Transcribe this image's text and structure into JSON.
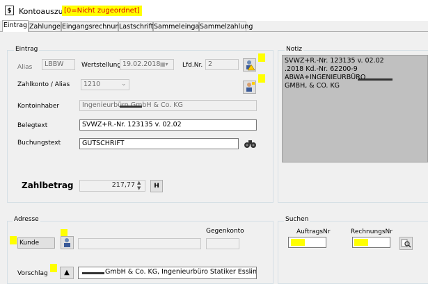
{
  "window": {
    "title": "Kontoauszug",
    "status": "[0=Nicht zugeordnet]"
  },
  "tabs": [
    "Eintrag",
    "Zahlungen",
    "Eingangsrechnung",
    "Lastschrift",
    "Sammeleingang",
    "Sammelzahlung"
  ],
  "entry": {
    "group_label": "Eintrag",
    "alias_label": "Alias",
    "alias_value": "LBBW",
    "wertstellung_label": "Wertstellung",
    "wertstellung_value": "19.02.2018",
    "lfdnr_label": "Lfd.Nr.",
    "lfdnr_value": "2",
    "zahlkonto_label": "Zahlkonto / Alias",
    "zahlkonto_value": "1210",
    "kontoinhaber_label": "Kontoinhaber",
    "kontoinhaber_value": "Ingenieurbüro            GmbH & Co. KG",
    "belegtext_label": "Belegtext",
    "belegtext_value": "SVWZ+R.-Nr. 123135 v. 02.02",
    "buchungstext_label": "Buchungstext",
    "buchungstext_value": "GUTSCHRIFT",
    "zahlbetrag_label": "Zahlbetrag",
    "zahlbetrag_value": "217,77",
    "h_button": "H"
  },
  "notiz": {
    "label": "Notiz",
    "lines": [
      "SVWZ+R.-Nr. 123135 v. 02.02",
      ".2018 Kd.-Nr. 62200-9",
      "ABWA+INGENIEURBÜRO",
      "GMBH, & CO. KG"
    ]
  },
  "adresse": {
    "label": "Adresse",
    "kunde_label": "Kunde",
    "gegenkonto_label": "Gegenkonto",
    "vorschlag_label": "Vorschlag",
    "vorschlag_value": "GmbH & Co. KG, Ingenieurbüro Statiker Esslingen am"
  },
  "suchen": {
    "label": "Suchen",
    "auftragsnr_label": "AuftragsNr",
    "rechnungsnr_label": "RechnungsNr"
  },
  "colors": {
    "highlight": "#ffff00",
    "status_text": "#e00000",
    "notes_bg": "#c0c0c0"
  },
  "icons": {
    "app": "document-dollar-icon",
    "lfdnr_button": "user-warning-icon",
    "zahlkonto_button": "user-search-icon",
    "buchungstext_button": "binoculars-icon",
    "kunde_button": "user-icon",
    "vorschlag_button": "triangle-up-icon",
    "search_button": "search-icon"
  }
}
